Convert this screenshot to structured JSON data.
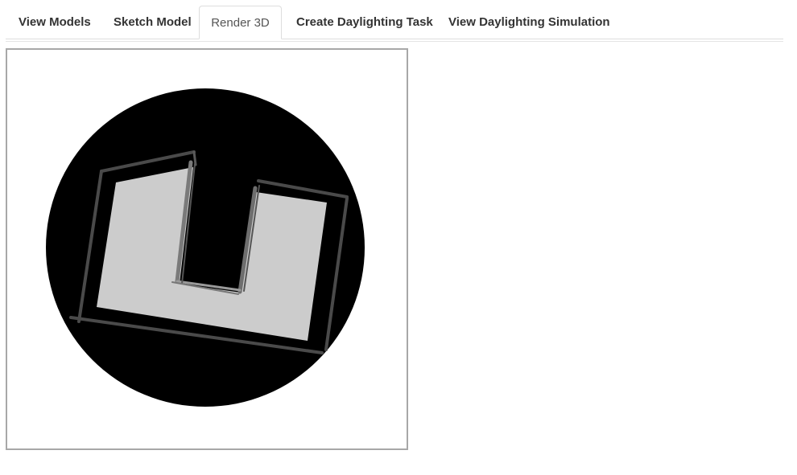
{
  "tabs": [
    {
      "label": "View Models",
      "active": false
    },
    {
      "label": "Sketch Model",
      "active": false
    },
    {
      "label": "Render 3D",
      "active": true
    },
    {
      "label": "Create Daylighting Task",
      "active": false
    },
    {
      "label": "View Daylighting Simulation",
      "active": false
    }
  ],
  "colors": {
    "background_disc": "#000000",
    "floor": "#cccccc",
    "walls": "#4a4a4a",
    "viewport_border": "#a8a8a8"
  }
}
